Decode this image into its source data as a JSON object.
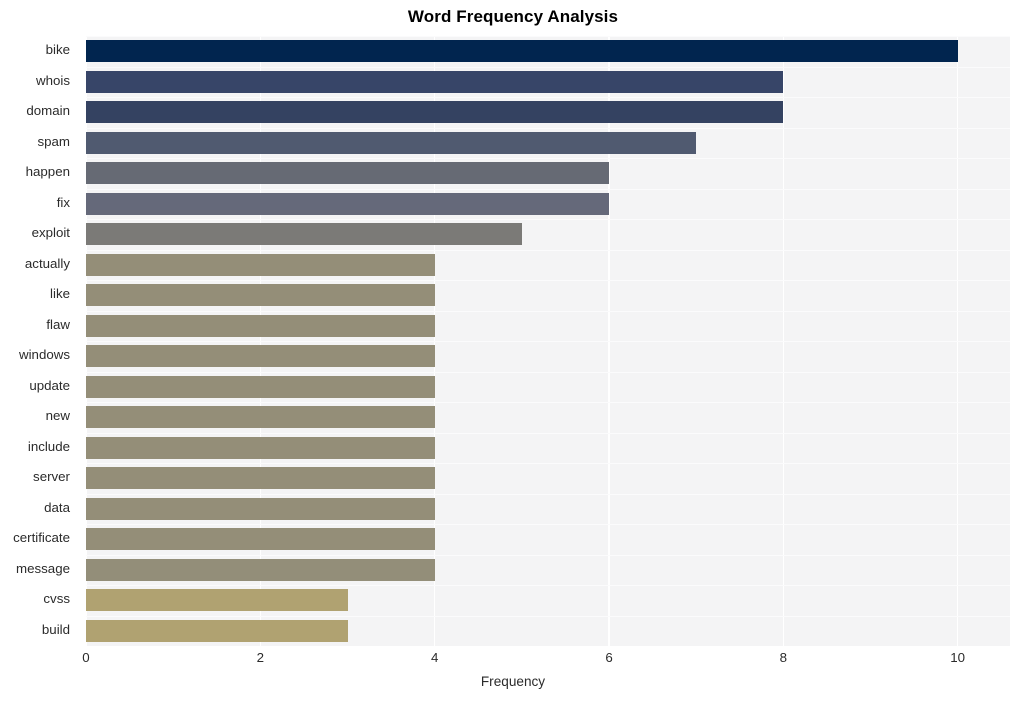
{
  "chart_data": {
    "type": "bar",
    "orientation": "horizontal",
    "title": "Word Frequency Analysis",
    "xlabel": "Frequency",
    "ylabel": "",
    "categories": [
      "bike",
      "whois",
      "domain",
      "spam",
      "happen",
      "fix",
      "exploit",
      "actually",
      "like",
      "flaw",
      "windows",
      "update",
      "new",
      "include",
      "server",
      "data",
      "certificate",
      "message",
      "cvss",
      "build"
    ],
    "values": [
      10,
      8,
      8,
      7,
      6,
      6,
      5,
      4,
      4,
      4,
      4,
      4,
      4,
      4,
      4,
      4,
      4,
      4,
      3,
      3
    ],
    "bar_colors": [
      "#01254f",
      "#374568",
      "#344261",
      "#505a70",
      "#666a74",
      "#65697a",
      "#7b7a77",
      "#948e78",
      "#948e78",
      "#948e78",
      "#948e78",
      "#948e78",
      "#948e78",
      "#948e78",
      "#948e78",
      "#948e78",
      "#948e78",
      "#938e79",
      "#b0a271",
      "#b0a271"
    ],
    "xlim": [
      0,
      10.6
    ],
    "xticks": [
      0,
      2,
      4,
      6,
      8,
      10
    ],
    "xtick_labels": [
      "0",
      "2",
      "4",
      "6",
      "8",
      "10"
    ],
    "grid": true,
    "grid_color": "#ffffff",
    "plot_background": "#f4f4f5",
    "figure_background": "#ffffff",
    "legend": null
  }
}
